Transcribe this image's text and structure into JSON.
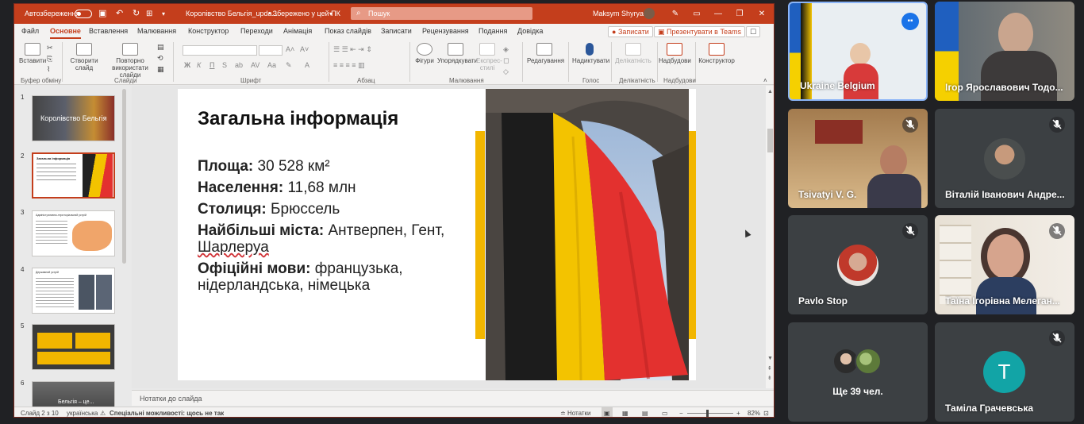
{
  "titlebar": {
    "autosave": "Автозбереження",
    "doc_title": "Королівство Бельгія_upda...",
    "saved": "• Збережено у цей ПК",
    "search": "Пошук",
    "user": "Maksym Shyryaev"
  },
  "tabs": [
    "Файл",
    "Основне",
    "Вставлення",
    "Малювання",
    "Конструктор",
    "Переходи",
    "Анімація",
    "Показ слайдів",
    "Записати",
    "Рецензування",
    "Подання",
    "Довідка"
  ],
  "record_button": "Записати",
  "teams_button": "Презентувати в Teams",
  "ribbon": {
    "paste": "Вставити",
    "new_slide": "Створити слайд",
    "reuse": "Повторно використати слайди",
    "shapes": "Фігури",
    "arrange": "Упорядкувати",
    "styles": "Експрес-стилі",
    "editing": "Редагування",
    "dictate": "Надиктувати",
    "sensitivity": "Делікатність",
    "addins": "Надбудови",
    "designer": "Конструктор",
    "groups": [
      "Буфер обміну",
      "Слайди",
      "Шрифт",
      "Абзац",
      "Малювання",
      "Голос",
      "Делікатність",
      "Надбудови"
    ]
  },
  "thumbs": [
    {
      "n": "1",
      "title": "Королівство Бельгія"
    },
    {
      "n": "2",
      "title": "Загальна інформація"
    },
    {
      "n": "3",
      "title": "Адміністративно-територіальний устрій"
    },
    {
      "n": "4",
      "title": "Державний устрій"
    },
    {
      "n": "5",
      "title": ""
    },
    {
      "n": "6",
      "title": "Бельгія – це..."
    }
  ],
  "slide": {
    "title": "Загальна інформація",
    "rows": [
      {
        "label": "Площа:",
        "value": " 30 528 км²"
      },
      {
        "label": "Населення:",
        "value": " 11,68 млн"
      },
      {
        "label": "Столиця:",
        "value": " Брюссель"
      },
      {
        "label": "Найбільші міста:",
        "value": " Антверпен, Гент,",
        "cont": "Шарлеруа"
      },
      {
        "label": "Офіційні мови:",
        "value": " французька,",
        "cont": "нідерландська, німецька"
      }
    ]
  },
  "notes_placeholder": "Нотатки до слайда",
  "status": {
    "slide": "Слайд 2 з 10",
    "lang": "українська",
    "access": "Спеціальні можливості: щось не так",
    "notes": "Нотатки",
    "zoom": "82%"
  },
  "participants": [
    {
      "name": "Ukraine Belgium",
      "muted": false
    },
    {
      "name": "Ігор Ярославович Тодо...",
      "muted": false
    },
    {
      "name": "Tsivatyi V. G.",
      "muted": true
    },
    {
      "name": "Віталій Іванович Андре...",
      "muted": true
    },
    {
      "name": "Pavlo Stop",
      "muted": true
    },
    {
      "name": "Таїна Ігорівна Мелеган...",
      "muted": true
    },
    {
      "name": "Ще 39 чел.",
      "muted": false
    },
    {
      "name": "Таміла Грачевська",
      "muted": true,
      "initial": "T"
    }
  ],
  "colors": {
    "ppt_accent": "#c43e1c",
    "meet_bg": "#202124",
    "tile_bg": "#3c4043",
    "flag_black": "#1c1c1c",
    "flag_yellow": "#f3c300",
    "flag_red": "#e3312f",
    "avatar_teal": "#12a4a6"
  }
}
